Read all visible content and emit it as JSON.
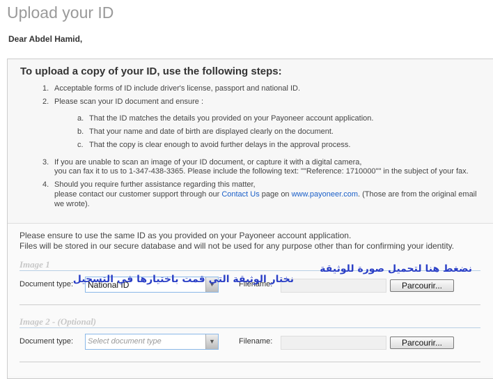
{
  "title": "Upload your ID",
  "greeting": "Dear Abdel Hamid,",
  "steps": {
    "heading": "To upload a copy of your ID, use the following steps:",
    "s1": "Acceptable forms of ID include driver's license, passport and national ID.",
    "s2": "Please scan your ID document and ensure :",
    "a": "That the ID matches the details you provided on your Payoneer account application.",
    "b": "That your name and date of birth are displayed clearly on the document.",
    "c": "That the copy is clear enough to avoid further delays in the approval process.",
    "s3a": "If you are unable to scan an image of your ID document, or capture it with a digital camera,",
    "s3b": "you can fax it to us to 1-347-438-3365. Please include the following text: \"\"Reference: 1710000\"\" in the subject of your fax.",
    "s4a": "Should you require further assistance regarding this matter,",
    "s4b_pre": "please contact our customer support through our ",
    "contact_link": "Contact Us",
    "s4b_mid": " page on ",
    "site_link": "www.payoneer.com",
    "s4b_post": ". (Those are from the original email",
    "s4c": "we wrote)."
  },
  "notice1": "Please ensure to use the same ID as you provided on your Payoneer account application.",
  "notice2": "Files will be stored in our secure database and will not be used for any purpose other than for confirming your identity.",
  "image1": {
    "title": "Image 1",
    "doc_label": "Document type:",
    "doc_value": "National ID",
    "file_label": "Filename:",
    "browse": "Parcourir..."
  },
  "image2": {
    "title": "Image 2 - (Optional)",
    "doc_label": "Document type:",
    "doc_placeholder": "Select document type",
    "file_label": "Filename:",
    "browse": "Parcourir..."
  },
  "annotations": {
    "select_note": "نختار الوثيقة التي قمت باختيارها في التسجيل",
    "upload_note": "نضغط هنا لتحميل صورة للوثيقة"
  },
  "colors": {
    "annotation": "#2a3fc6",
    "link": "#1a5fc8"
  }
}
